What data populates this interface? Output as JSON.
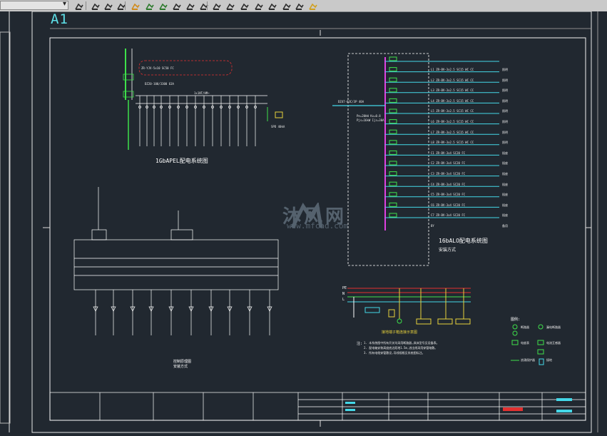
{
  "app": {
    "toolbar": {
      "combo_value": "",
      "buttons": [
        "draw-icon",
        "layer-icon",
        "layer-state-icon",
        "layer-props-icon",
        "match-icon",
        "layer-prev-icon",
        "layer-iso-icon",
        "layer-off-icon",
        "layer-freeze-icon",
        "layer-lock-icon",
        "layer-walk-icon",
        "layer-merge-icon",
        "layer-delete-icon",
        "layer-unisolate-icon",
        "layer-on-icon",
        "layer-thaw-icon",
        "layer-unlock-icon",
        "lock-icon"
      ]
    }
  },
  "drawing": {
    "sheet_size": "A1",
    "watermark": {
      "brand": "沐风网",
      "url": "www.mfcad.com"
    },
    "top_panel": {
      "title": "1GbAPEL配电系统图",
      "cable_spec": "ZR-YJV-5x10 SC50 FC",
      "main_breaker": "DZ20-100/3300 63A",
      "surge": "SPD 40kA",
      "enclosure_spec": "1x1NT/HM~"
    },
    "lighting_panel": {
      "title": "16bALO配电系统图",
      "subtitle": "安装方式",
      "supply": "Pe=20kW Kx=0.8 Pjs=16kW Ijs=30A",
      "incoming_breaker": "DZ47-63C/3P 40A",
      "circuits": [
        {
          "id": "L1",
          "spec": "ZR-BV-3x2.5 SC15 WC CC",
          "load": "照明"
        },
        {
          "id": "L2",
          "spec": "ZR-BV-3x2.5 SC15 WC CC",
          "load": "照明"
        },
        {
          "id": "L3",
          "spec": "ZR-BV-3x2.5 SC15 WC CC",
          "load": "照明"
        },
        {
          "id": "L4",
          "spec": "ZR-BV-3x2.5 SC15 WC CC",
          "load": "照明"
        },
        {
          "id": "L5",
          "spec": "ZR-BV-3x2.5 SC15 WC CC",
          "load": "照明"
        },
        {
          "id": "L6",
          "spec": "ZR-BV-3x2.5 SC15 WC CC",
          "load": "照明"
        },
        {
          "id": "L7",
          "spec": "ZR-BV-3x2.5 SC15 WC CC",
          "load": "照明"
        },
        {
          "id": "L8",
          "spec": "ZR-BV-3x2.5 SC15 WC CC",
          "load": "照明"
        },
        {
          "id": "C1",
          "spec": "ZR-BV-3x4 SC20 FC",
          "load": "插座"
        },
        {
          "id": "C2",
          "spec": "ZR-BV-3x4 SC20 FC",
          "load": "插座"
        },
        {
          "id": "C3",
          "spec": "ZR-BV-3x4 SC20 FC",
          "load": "插座"
        },
        {
          "id": "C4",
          "spec": "ZR-BV-3x4 SC20 FC",
          "load": "插座"
        },
        {
          "id": "C5",
          "spec": "ZR-BV-3x4 SC20 FC",
          "load": "插座"
        },
        {
          "id": "C6",
          "spec": "ZR-BV-3x4 SC20 FC",
          "load": "插座"
        },
        {
          "id": "C7",
          "spec": "ZR-BV-3x4 SC20 FC",
          "load": "插座"
        },
        {
          "id": "BY",
          "spec": "",
          "load": "备用"
        }
      ]
    },
    "control_panel": {
      "title": "控制原理图",
      "subtitle": "安装方式"
    },
    "bus_diagram": {
      "labels": [
        "PE",
        "N",
        "L"
      ],
      "note": "接地端子箱连接示意图"
    },
    "notes": {
      "heading": "注:",
      "lines": [
        "1. 本系统图中所有开关均采用断路器,具体型号见设备表。",
        "2. 配电箱安装高度底边距地1.5m,进出线采用穿管暗敷。",
        "3. 所有电缆穿管敷设,导线规格见系统图标注。"
      ]
    },
    "legend": {
      "heading": "图例:",
      "items": [
        "断路器",
        "漏电断路器",
        "电度表",
        "电流互感器",
        "浪涌保护器",
        "接地"
      ]
    },
    "title_block": {
      "project": "",
      "drawing_title": "",
      "sheet_no": ""
    },
    "colors": {
      "background": "#212830",
      "white": "#ffffff",
      "magenta": "#e040e0",
      "green": "#3ee04a",
      "cyan": "#44d8e8",
      "red": "#e23030",
      "yellow": "#e8d23c"
    }
  }
}
